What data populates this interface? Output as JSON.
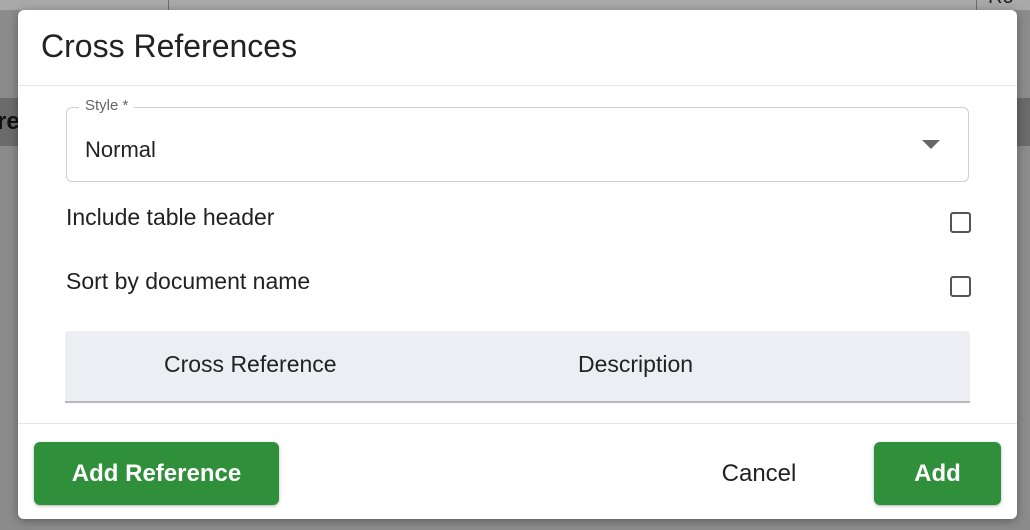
{
  "background": {
    "top_right_text": "Ro",
    "left_band_text": "re"
  },
  "dialog": {
    "title": "Cross References",
    "style_field": {
      "label": "Style *",
      "value": "Normal"
    },
    "options": {
      "include_table_header": {
        "label": "Include table header",
        "checked": false
      },
      "sort_by_document_name": {
        "label": "Sort by document name",
        "checked": false
      }
    },
    "table": {
      "columns": [
        "Cross Reference",
        "Description"
      ],
      "rows": []
    },
    "footer": {
      "add_reference_label": "Add Reference",
      "cancel_label": "Cancel",
      "add_label": "Add"
    }
  },
  "colors": {
    "primary_green": "#2f8f3a",
    "table_header_bg": "#eceef3"
  }
}
